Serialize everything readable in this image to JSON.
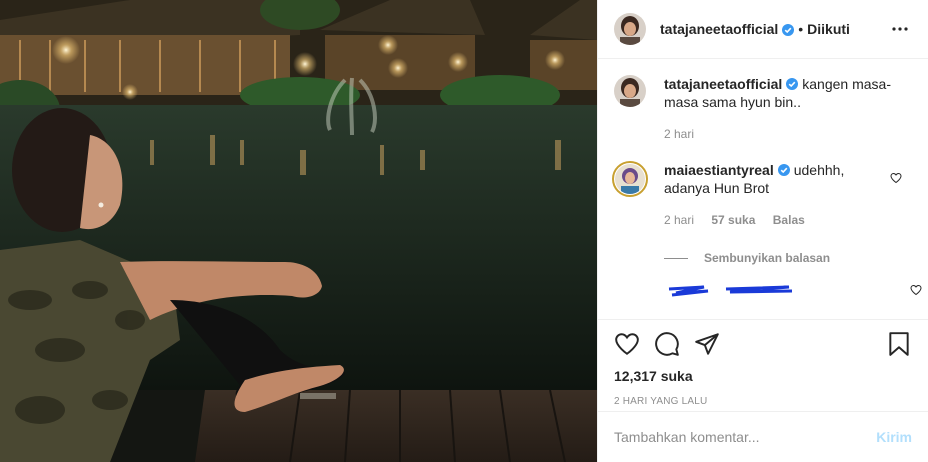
{
  "post": {
    "username": "tatajaneetaofficial",
    "follow_status": "Diikuti",
    "separator": "•",
    "caption": "kangen masa-masa sama hyun bin..",
    "caption_time": "2 hari",
    "likes": "12,317 suka",
    "posted_ago": "2 HARI YANG LALU"
  },
  "comments": [
    {
      "username": "maiaestiantyreal",
      "text": "udehhh, adanya Hun Brot",
      "time": "2 hari",
      "likes": "57 suka",
      "reply_label": "Balas",
      "hide_replies_label": "Sembunyikan balasan"
    }
  ],
  "add_comment": {
    "placeholder": "Tambahkan komentar...",
    "post_label": "Kirim"
  },
  "icons": {
    "more": "more-options-icon",
    "like": "heart-icon",
    "comment": "comment-icon",
    "share": "share-icon",
    "save": "bookmark-icon",
    "verified": "verified-badge-icon"
  },
  "colors": {
    "verified": "#3897f0",
    "post_button": "#b2dffc",
    "muted": "#8e8e8e",
    "text": "#262626"
  }
}
